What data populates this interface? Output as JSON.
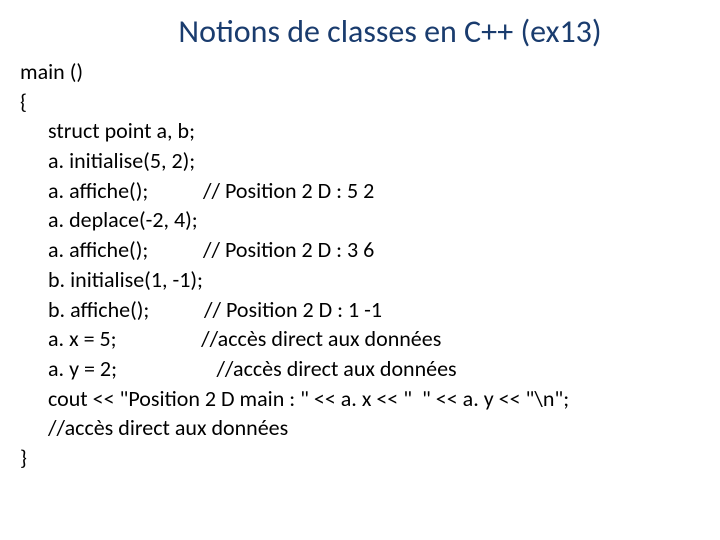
{
  "title": "Notions de classes en C++ (ex13)",
  "code": {
    "l0": "main ()",
    "l1": "{",
    "l2": "struct point a, b;",
    "l3": "a. initialise(5, 2);",
    "l4": "a. affiche();           // Position 2 D : 5 2",
    "l5": "a. deplace(-2, 4);",
    "l6": "a. affiche();           // Position 2 D : 3 6",
    "l7": "b. initialise(1, -1);",
    "l8": "b. affiche();           // Position 2 D : 1 -1",
    "l9": "a. x = 5;                 //accès direct aux données",
    "l10": "a. y = 2;                    //accès direct aux données",
    "l11": "cout << \"Position 2 D main : \" << a. x << \"  \" << a. y << \"\\n\";",
    "l12": "//accès direct aux données",
    "l13": "}"
  }
}
